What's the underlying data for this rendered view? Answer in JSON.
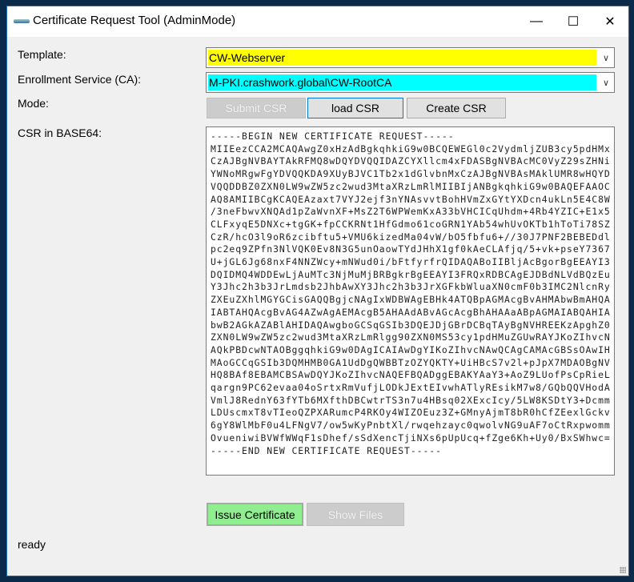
{
  "window": {
    "title": "Certificate Request Tool (AdminMode)",
    "minimize": "—",
    "maximize": "☐",
    "close": "✕"
  },
  "form": {
    "template_label": "Template:",
    "template_value": "CW-Webserver",
    "template_color": "#ffff00",
    "ca_label": "Enrollment Service (CA):",
    "ca_value": "M-PKI.crashwork.global\\CW-RootCA",
    "ca_color": "#00ffff",
    "mode_label": "Mode:",
    "csr_label": "CSR in BASE64:"
  },
  "mode_buttons": {
    "submit": "Submit CSR",
    "load": "load CSR",
    "create": "Create CSR"
  },
  "csr_lines": [
    "-----BEGIN NEW CERTIFICATE REQUEST-----",
    "MIIEezCCA2MCAQAwgZ0xHzAdBgkqhkiG9w0BCQEWEGl0c2VydmljZUB3cy5pdHMx",
    "CzAJBgNVBAYTAkRFMQ8wDQYDVQQIDAZCYXllcm4xFDASBgNVBAcMC0VyZ29sZHNi",
    "YWNoMRgwFgYDVQQKDA9XUyBJVC1Tb2x1dGlvbnMxCzAJBgNVBAsMAklUMR8wHQYD",
    "VQQDDBZ0ZXN0LW9wZW5zc2wud3MtaXRzLmRlMIIBIjANBgkqhkiG9w0BAQEFAAOC",
    "AQ8AMIIBCgKCAQEAzaxt7VYJ2ejf3nYNAsvvtBohHVmZxGYtYXDcn4ukLn5E4C8W",
    "/3neFbwvXNQAd1pZaWvnXF+MsZ2T6WPWemKxA33bVHCICqUhdm+4Rb4YZIC+E1x5",
    "CLFxyqE5DNXc+tgGK+fpCCKRNt1HfGdmo61coGRN1YAb54whUvOKTb1hToTi78SZ",
    "CzR/hcO3l9oR6zcibftu5+VMU6kizedMa04vW/bO5fbfu6+//30J7PNF2BEBEDdl",
    "pc2eq9ZPfn3NlVQK0Ev8N3G5unOaowTYdJHhX1gf0kAeCLAfjq/5+vk+pseY7367",
    "U+jGL6Jg68nxF4NNZWcy+mNWud0i/bFtfyrfrQIDAQABoIIBljAcBgorBgEEAYI3",
    "DQIDMQ4WDDEwLjAuMTc3NjMuMjBRBgkrBgEEAYI3FRQxRDBCAgEJDBdNLVdBQzEu",
    "Y3Jhc2h3b3JrLmdsb2JhbAwXY3Jhc2h3b3JrXGFkbWluaXN0cmF0b3IMC2NlcnRy",
    "ZXEuZXhlMGYGCisGAQQBgjcNAgIxWDBWAgEBHk4ATQBpAGMAcgBvAHMAbwBmAHQA",
    "IABTAHQAcgBvAG4AZwAgAEMAcgB5AHAAdABvAGcAcgBhAHAAaABpAGMAIABQAHIA",
    "bwB2AGkAZABlAHIDAQAwgboGCSqGSIb3DQEJDjGBrDCBqTAyBgNVHREEKzApghZ0",
    "ZXN0LW9wZW5zc2wud3MtaXRzLmRlgg90ZXN0MS53cy1pdHMuZGUwRAYJKoZIhvcN",
    "AQkPBDcwNTAOBggqhkiG9w0DAgICAIAwDgYIKoZIhvcNAwQCAgCAMAcGBSsOAwIH",
    "MAoGCCqGSIb3DQMHMB0GA1UdDgQWBBTzOZYQKTY+UiHBcS7v2l+pJpX7MDAOBgNV",
    "HQ8BAf8EBAMCBSAwDQYJKoZIhvcNAQEFBQADggEBAKYAaY3+AoZ9LUofPsCpRieL",
    "qargn9PC62evaa04oSrtxRmVufjLODkJExtEIvwhATlyREsikM7w8/GQbQQVHodA",
    "VmlJ8RednY63fYTb6MXfthDBCwtrTS3n7u4HBsq02XExcIcy/5LW8KSDtY3+Dcmm",
    "LDUscmxT8vTIeoQZPXARumcP4RKOy4WIZOEuz3Z+GMnyAjmT8bR0hCfZEexlGckv",
    "6gY8WlMbF0u4LFNgV7/ow5wKyPnbtXl/rwqehzayc0qwolvNG9uAF7oCtRxpwomm",
    "OvueniwiBVWfWWqF1sDhef/sSdXencTjiNXs6pUpUcq+fZge6Kh+Uy0/BxSWhwc=",
    "-----END NEW CERTIFICATE REQUEST-----"
  ],
  "actions": {
    "issue": "Issue Certificate",
    "issue_color": "#90ee90",
    "show_files": "Show Files"
  },
  "status": "ready"
}
